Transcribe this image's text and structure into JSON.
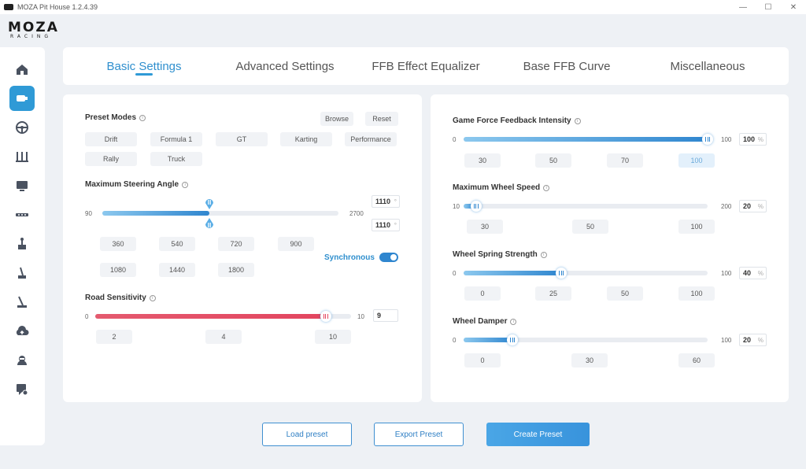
{
  "window": {
    "title": "MOZA Pit House 1.2.4.39",
    "minimize": "—",
    "maximize": "☐",
    "close": "✕"
  },
  "logo": {
    "main": "MOZA",
    "sub": "RACING"
  },
  "sidebar": {
    "items": [
      {
        "icon": "home-icon"
      },
      {
        "icon": "wheelbase-icon",
        "active": true
      },
      {
        "icon": "steering-wheel-icon"
      },
      {
        "icon": "pedals-icon"
      },
      {
        "icon": "dashboard-icon"
      },
      {
        "icon": "led-bar-icon"
      },
      {
        "icon": "shifter-icon"
      },
      {
        "icon": "handbrake-icon"
      },
      {
        "icon": "handbrake-lever-icon"
      },
      {
        "icon": "cloud-upload-icon"
      },
      {
        "icon": "user-profile-icon"
      },
      {
        "icon": "support-chat-icon"
      }
    ]
  },
  "tabs": [
    {
      "label": "Basic Settings",
      "active": true
    },
    {
      "label": "Advanced Settings"
    },
    {
      "label": "FFB Effect Equalizer"
    },
    {
      "label": "Base FFB Curve"
    },
    {
      "label": "Miscellaneous"
    }
  ],
  "left_panel": {
    "preset_modes": {
      "label": "Preset Modes",
      "browse": "Browse",
      "reset": "Reset",
      "modes": [
        "Drift",
        "Formula 1",
        "GT",
        "Karting",
        "Performance",
        "Rally",
        "Truck"
      ]
    },
    "steering_angle": {
      "label": "Maximum Steering Angle",
      "min": "90",
      "max": "2700",
      "value": 1110,
      "value_display": "1110",
      "lock_value_display": "1110",
      "unit": "°",
      "fraction": 0.453,
      "presets": [
        "360",
        "540",
        "720",
        "900",
        "1080",
        "1440",
        "1800"
      ],
      "sync_label": "Synchronous",
      "sync_on": true
    },
    "road_sensitivity": {
      "label": "Road Sensitivity",
      "min": "0",
      "max": "10",
      "value": 9,
      "value_display": "9",
      "fraction": 0.9,
      "presets": [
        "2",
        "4",
        "10"
      ]
    }
  },
  "right_panel": {
    "sliders": [
      {
        "label": "Game Force Feedback Intensity",
        "min": "0",
        "max": "100",
        "value_display": "100",
        "unit": "%",
        "fraction": 1.0,
        "presets": [
          "30",
          "50",
          "70",
          "100"
        ],
        "selected": 3
      },
      {
        "label": "Maximum Wheel Speed",
        "min": "10",
        "max": "200",
        "value_display": "20",
        "unit": "%",
        "fraction": 0.05,
        "presets": [
          "30",
          "50",
          "100"
        ]
      },
      {
        "label": "Wheel Spring Strength",
        "min": "0",
        "max": "100",
        "value_display": "40",
        "unit": "%",
        "fraction": 0.4,
        "presets": [
          "0",
          "25",
          "50",
          "100"
        ]
      },
      {
        "label": "Wheel Damper",
        "min": "0",
        "max": "100",
        "value_display": "20",
        "unit": "%",
        "fraction": 0.2,
        "presets": [
          "0",
          "30",
          "60"
        ]
      }
    ]
  },
  "actions": {
    "load": "Load preset",
    "export": "Export Preset",
    "create": "Create Preset"
  },
  "colors": {
    "accent": "#2f86cf",
    "road": "#e3455f",
    "active_nav": "#2f9ad6"
  }
}
